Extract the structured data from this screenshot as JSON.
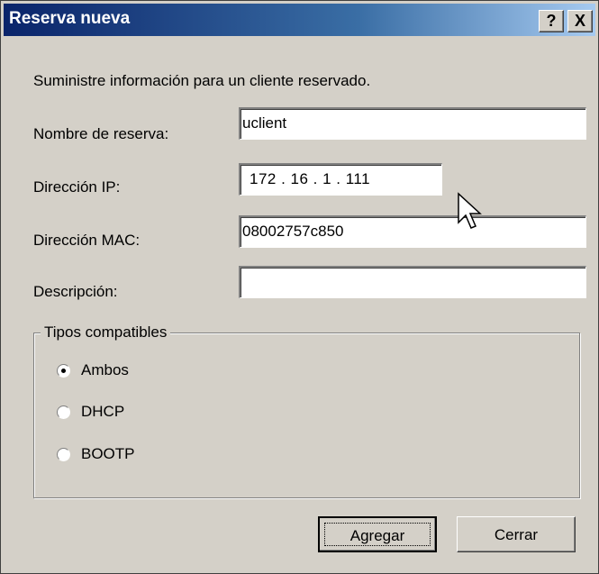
{
  "window": {
    "title": "Reserva nueva",
    "help_label": "?",
    "close_label": "X"
  },
  "intro": "Suministre información para un cliente reservado.",
  "fields": {
    "name": {
      "label": "Nombre de reserva:",
      "value": "uclient"
    },
    "ip": {
      "label": "Dirección IP:",
      "value": "172 .  16  .   1   . 111"
    },
    "mac": {
      "label": "Dirección MAC:",
      "value": "08002757c850"
    },
    "description": {
      "label": "Descripción:",
      "value": ""
    }
  },
  "types": {
    "title": "Tipos compatibles",
    "options": [
      {
        "label": "Ambos",
        "checked": true
      },
      {
        "label": "DHCP",
        "checked": false
      },
      {
        "label": "BOOTP",
        "checked": false
      }
    ]
  },
  "buttons": {
    "add": "Agregar",
    "close": "Cerrar"
  }
}
